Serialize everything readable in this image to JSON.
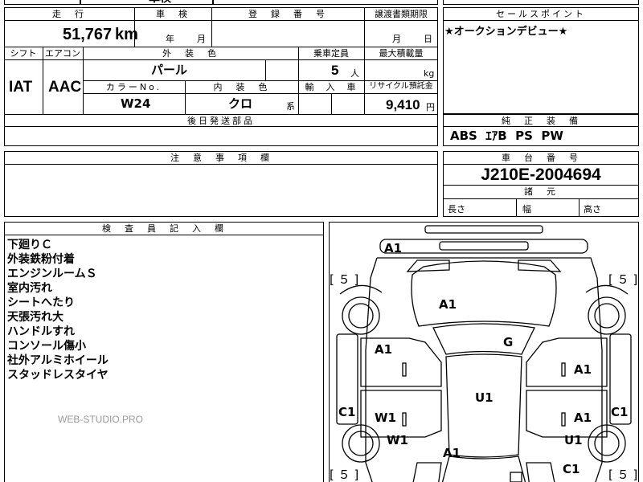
{
  "top_strip": {
    "partial_text": "車検"
  },
  "mileage": {
    "header": "走　行",
    "value": "51,767",
    "unit": "km"
  },
  "inspection": {
    "header": "車　検",
    "year_unit": "年",
    "month_unit": "月"
  },
  "registration": {
    "header": "登　録　番　号",
    "value": ""
  },
  "transfer": {
    "header": "譲渡書類期限",
    "month_unit": "月",
    "day_unit": "日"
  },
  "sales_point": {
    "header": "セールスポイント",
    "text": "★オークションデビュー★"
  },
  "shift": {
    "header": "シフト",
    "value": "IAT"
  },
  "aircon": {
    "header": "エアコン",
    "value": "AAC"
  },
  "exterior_color": {
    "header": "外　装　色",
    "value": "パール"
  },
  "capacity": {
    "header": "乗車定員",
    "value": "5",
    "unit": "人"
  },
  "max_load": {
    "header": "最大積載量",
    "unit": "kg"
  },
  "color_no": {
    "header": "カラーNo.",
    "value": "W24"
  },
  "interior_color": {
    "header": "内　装　色",
    "value": "クロ",
    "suffix": "系"
  },
  "import": {
    "header": "輸　入　車"
  },
  "recycle": {
    "header": "リサイクル預託金",
    "value": "9,410",
    "unit": "円"
  },
  "parts": {
    "header": "後日発送部品",
    "value": ""
  },
  "equipment": {
    "header": "純　正　装　備",
    "value": "ABS  ｴｱB  PS  PW"
  },
  "cautions": {
    "header": "注　意　事　項　欄",
    "value": ""
  },
  "chassis": {
    "header": "車　台　番　号",
    "value": "J210E-2004694"
  },
  "dimensions": {
    "header": "諸　元",
    "length": "長さ",
    "width": "幅",
    "height": "高さ"
  },
  "inspector": {
    "header": "検　査　員　記　入　欄",
    "notes": [
      "下廻りＣ",
      "外装鉄粉付着",
      "エンジンルームＳ",
      "室内汚れ",
      "シートへたり",
      "天張汚れ大",
      "ハンドルすれ",
      "コンソール傷小",
      "社外アルミホイール",
      "スタッドレスタイヤ"
    ]
  },
  "watermark": "WEB-STUDIO.PRO",
  "diagram": {
    "tread_fl": "５",
    "tread_fr": "５",
    "tread_rl": "５",
    "tread_rr": "５",
    "marks": {
      "front_bumper": "A1",
      "hood": "A1",
      "roof": "G",
      "left_front_door": "A1",
      "right_front_door": "A1",
      "center": "U1",
      "left_rear_door": "W1",
      "right_rear_door": "A1",
      "left_fender_front": "C1",
      "right_fender_front": "C1",
      "left_quarter": "W1",
      "right_quarter": "U1",
      "trunk": "A1",
      "rear_bumper": "C1"
    }
  }
}
